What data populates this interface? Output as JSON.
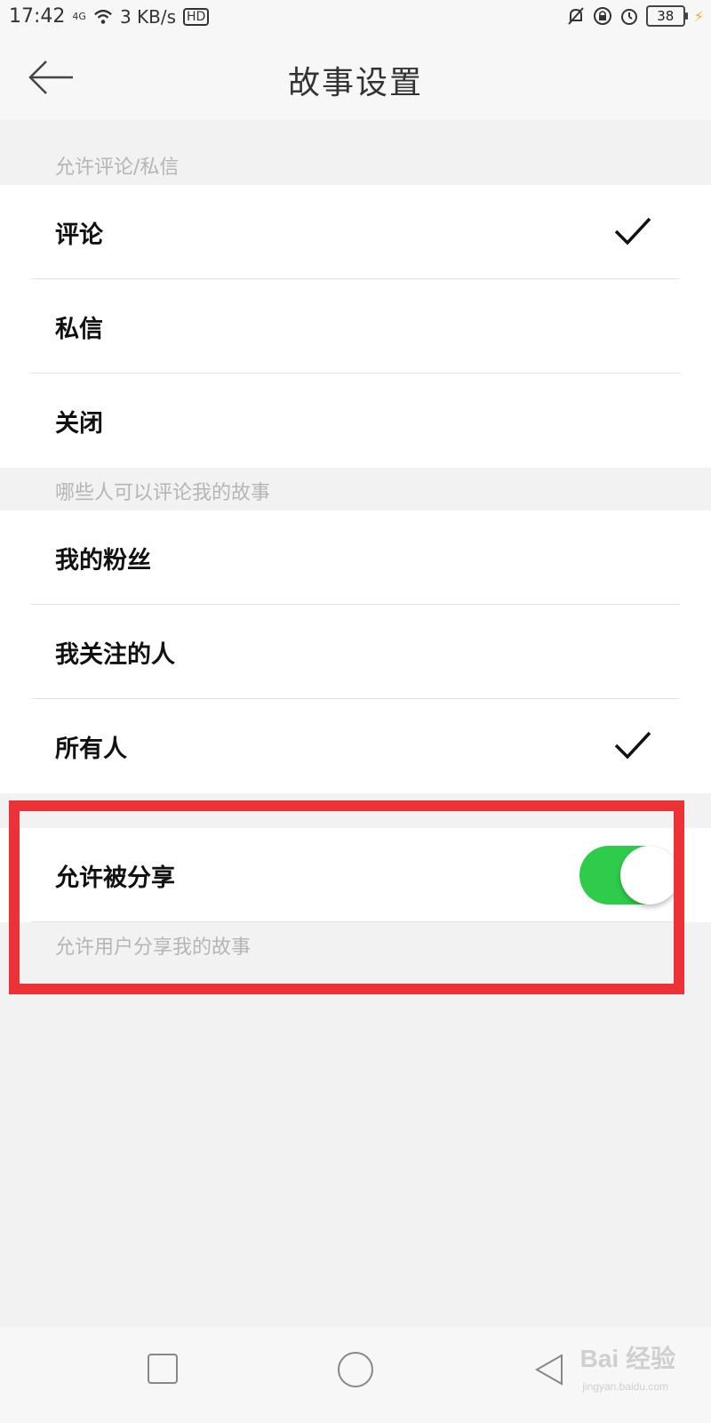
{
  "status_bar": {
    "time": "17:42",
    "signal": "4G",
    "speed": "3 KB/s",
    "hd": "HD",
    "battery": "38",
    "icons": [
      "wifi-icon",
      "bell-off-icon",
      "lock-rotation-icon",
      "alarm-icon",
      "battery-icon",
      "charging-icon"
    ]
  },
  "nav": {
    "title": "故事设置",
    "back_icon": "arrow-left-icon"
  },
  "sections": {
    "comments_header": "允许评论/私信",
    "comments_options": [
      {
        "label": "评论",
        "checked": true
      },
      {
        "label": "私信",
        "checked": false
      },
      {
        "label": "关闭",
        "checked": false
      }
    ],
    "audience_header": "哪些人可以评论我的故事",
    "audience_options": [
      {
        "label": "我的粉丝",
        "checked": false
      },
      {
        "label": "我关注的人",
        "checked": false
      },
      {
        "label": "所有人",
        "checked": true
      }
    ],
    "share": {
      "label": "允许被分享",
      "enabled": true,
      "hint": "允许用户分享我的故事"
    }
  },
  "colors": {
    "toggle_on": "#2ecc4a",
    "highlight": "#ec3237"
  },
  "bottom_nav": {
    "icons": [
      "recent-apps-icon",
      "home-icon",
      "back-icon"
    ]
  },
  "watermark": {
    "text": "Bai 经验",
    "url": "jingyan.baidu.com"
  }
}
